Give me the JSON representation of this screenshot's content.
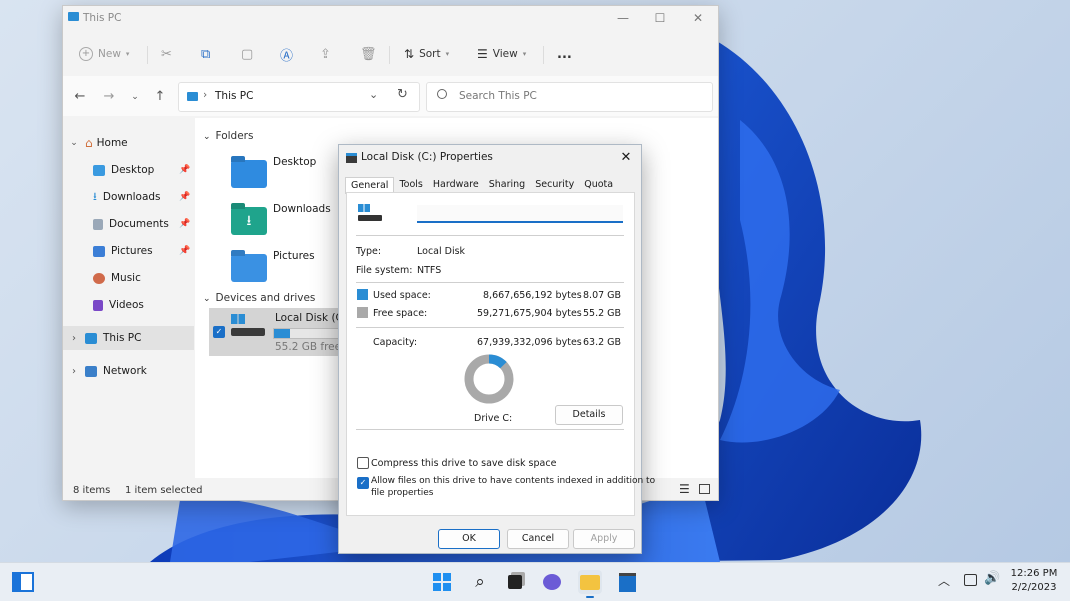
{
  "explorer": {
    "title": "This PC",
    "toolbar": {
      "new": "New",
      "sort": "Sort",
      "view": "View",
      "more": "..."
    },
    "address": {
      "crumb": "This PC"
    },
    "search": {
      "placeholder": "Search This PC"
    },
    "sidebar": {
      "home": "Home",
      "items": [
        "Desktop",
        "Downloads",
        "Documents",
        "Pictures",
        "Music",
        "Videos"
      ],
      "this_pc": "This PC",
      "network": "Network"
    },
    "content": {
      "folders_header": "Folders",
      "folders": [
        "Desktop",
        "Downloads",
        "Pictures"
      ],
      "devices_header": "Devices and drives",
      "drive_name": "Local Disk (C:)",
      "drive_free": "55.2 GB free of",
      "drive_used_fraction": 0.13
    },
    "status": {
      "count": "8 items",
      "selected": "1 item selected"
    }
  },
  "dialog": {
    "title": "Local Disk (C:) Properties",
    "tabs": [
      "General",
      "Tools",
      "Hardware",
      "Sharing",
      "Security",
      "Quota"
    ],
    "name_value": "",
    "type_label": "Type:",
    "type_value": "Local Disk",
    "fs_label": "File system:",
    "fs_value": "NTFS",
    "used_label": "Used space:",
    "used_bytes": "8,667,656,192 bytes",
    "used_gb": "8.07 GB",
    "free_label": "Free space:",
    "free_bytes": "59,271,675,904 bytes",
    "free_gb": "55.2 GB",
    "capacity_label": "Capacity:",
    "capacity_bytes": "67,939,332,096 bytes",
    "capacity_gb": "63.2 GB",
    "drive_label": "Drive C:",
    "details_button": "Details",
    "compress_label": "Compress this drive to save disk space",
    "index_label_1": "Allow files on this drive to have contents indexed in addition to",
    "index_label_2": "file properties",
    "ok": "OK",
    "cancel": "Cancel",
    "apply": "Apply",
    "used_color": "#2a8dd4",
    "free_color": "#a9a9a9",
    "used_fraction": 0.128
  },
  "tray": {
    "time": "12:26 PM",
    "date": "2/2/2023"
  }
}
